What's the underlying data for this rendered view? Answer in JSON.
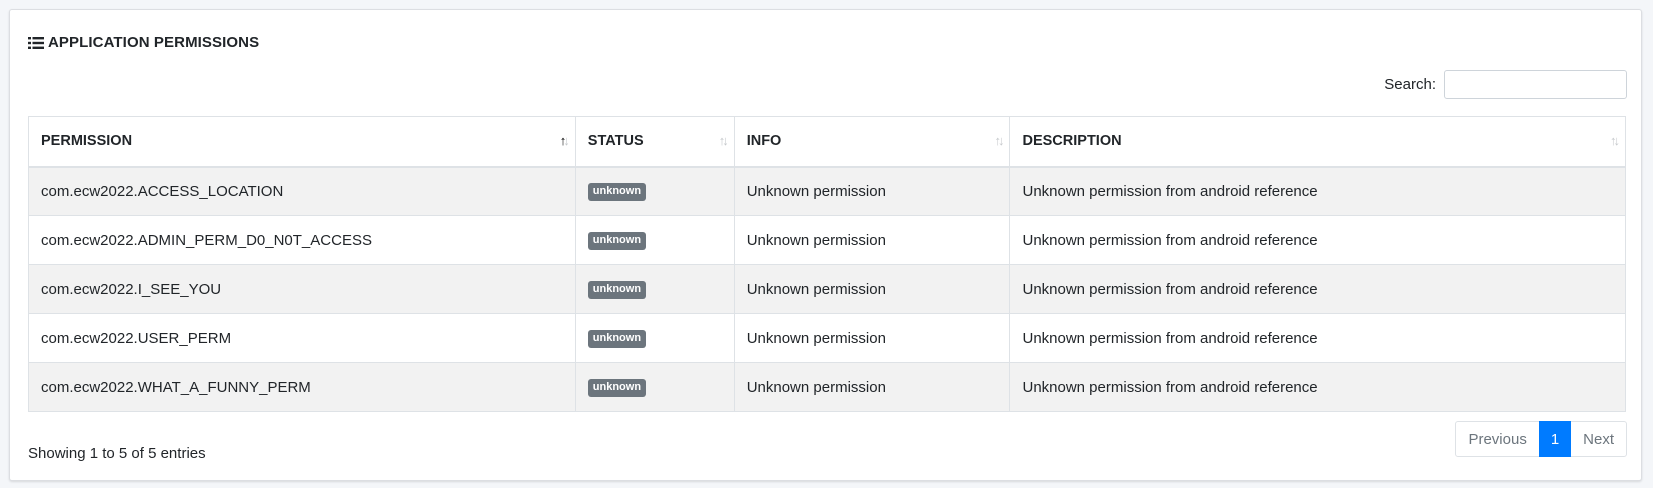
{
  "card": {
    "title": "APPLICATION PERMISSIONS",
    "title_icon": "list-icon"
  },
  "search": {
    "label": "Search:",
    "value": "",
    "placeholder": ""
  },
  "table": {
    "columns": [
      {
        "label": "PERMISSION",
        "sort": "ascending"
      },
      {
        "label": "STATUS",
        "sort": "none"
      },
      {
        "label": "INFO",
        "sort": "none"
      },
      {
        "label": "DESCRIPTION",
        "sort": "none"
      }
    ],
    "rows": [
      {
        "permission": "com.ecw2022.ACCESS_LOCATION",
        "status": "unknown",
        "info": "Unknown permission",
        "description": "Unknown permission from android reference"
      },
      {
        "permission": "com.ecw2022.ADMIN_PERM_D0_N0T_ACCESS",
        "status": "unknown",
        "info": "Unknown permission",
        "description": "Unknown permission from android reference"
      },
      {
        "permission": "com.ecw2022.I_SEE_YOU",
        "status": "unknown",
        "info": "Unknown permission",
        "description": "Unknown permission from android reference"
      },
      {
        "permission": "com.ecw2022.USER_PERM",
        "status": "unknown",
        "info": "Unknown permission",
        "description": "Unknown permission from android reference"
      },
      {
        "permission": "com.ecw2022.WHAT_A_FUNNY_PERM",
        "status": "unknown",
        "info": "Unknown permission",
        "description": "Unknown permission from android reference"
      }
    ]
  },
  "footer": {
    "info": "Showing 1 to 5 of 5 entries"
  },
  "pagination": {
    "previous": "Previous",
    "current_page": "1",
    "next": "Next"
  },
  "colors": {
    "accent": "#007bff",
    "badge_unknown": "#6c757d",
    "striped_row": "#f2f2f2"
  }
}
